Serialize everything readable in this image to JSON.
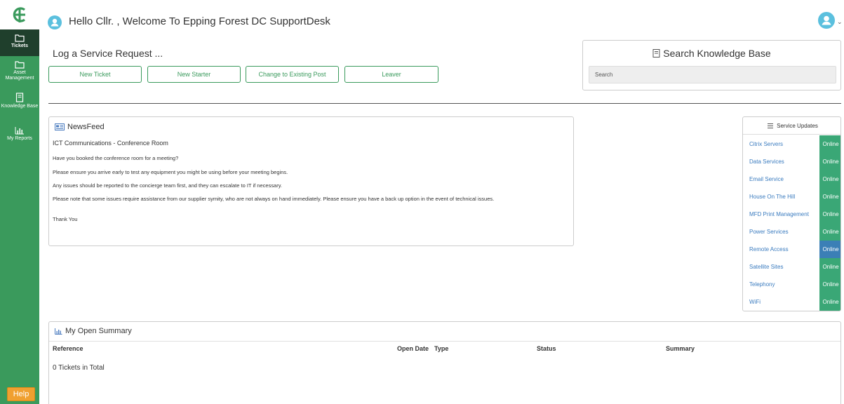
{
  "sidebar": {
    "items": [
      {
        "label": "Tickets",
        "icon": "folder-icon",
        "active": true
      },
      {
        "label": "Asset Management",
        "icon": "folder-icon",
        "active": false
      },
      {
        "label": "Knowledge Base",
        "icon": "book-icon",
        "active": false
      },
      {
        "label": "My Reports",
        "icon": "bar-chart-icon",
        "active": false
      }
    ],
    "help_label": "Help"
  },
  "header": {
    "greeting": "Hello Cllr.  , Welcome To Epping Forest DC SupportDesk"
  },
  "service_request": {
    "title": "Log a Service Request ...",
    "buttons": [
      "New Ticket",
      "New Starter",
      "Change to Existing Post",
      "Leaver"
    ]
  },
  "knowledge_base": {
    "title": "Search Knowledge Base",
    "search_placeholder": "Search"
  },
  "newsfeed": {
    "heading": "NewsFeed",
    "title": "ICT Communications - Conference Room",
    "paragraphs": [
      "Have you booked the conference room for a meeting?",
      "Please ensure you arrive early to test any equipment you might be using before your meeting begins.",
      "Any issues should be reported to the concierge team first, and they can escalate to IT if necessary.",
      "Please note that some issues require assistance from our supplier symity, who are not always on hand immediately. Please ensure you have a back up option in the event of technical issues.",
      "Thank You"
    ]
  },
  "service_updates": {
    "heading": "Service Updates",
    "items": [
      {
        "name": "Citrix Servers",
        "status": "Online",
        "color": "#3aa776"
      },
      {
        "name": "Data Services",
        "status": "Online",
        "color": "#3aa776"
      },
      {
        "name": "Email Service",
        "status": "Online",
        "color": "#3aa776"
      },
      {
        "name": "House On The Hill",
        "status": "Online",
        "color": "#3aa776"
      },
      {
        "name": "MFD Print Management",
        "status": "Online",
        "color": "#3aa776"
      },
      {
        "name": "Power Services",
        "status": "Online",
        "color": "#3aa776"
      },
      {
        "name": "Remote Access",
        "status": "Online",
        "color": "#3b7fb6"
      },
      {
        "name": "Satellite Sites",
        "status": "Online",
        "color": "#3aa776"
      },
      {
        "name": "Telephony",
        "status": "Online",
        "color": "#3aa776"
      },
      {
        "name": "WiFi",
        "status": "Online",
        "color": "#3aa776"
      }
    ]
  },
  "open_summary": {
    "heading": "My Open Summary",
    "columns": [
      "Reference",
      "Open Date",
      "Type",
      "Status",
      "Summary"
    ],
    "total_text": "0 Tickets in Total"
  },
  "colors": {
    "brand_green": "#3a9a5c",
    "sidebar_active": "#1f3f2c",
    "help_orange": "#f0a030",
    "avatar_blue": "#5bc0de"
  }
}
